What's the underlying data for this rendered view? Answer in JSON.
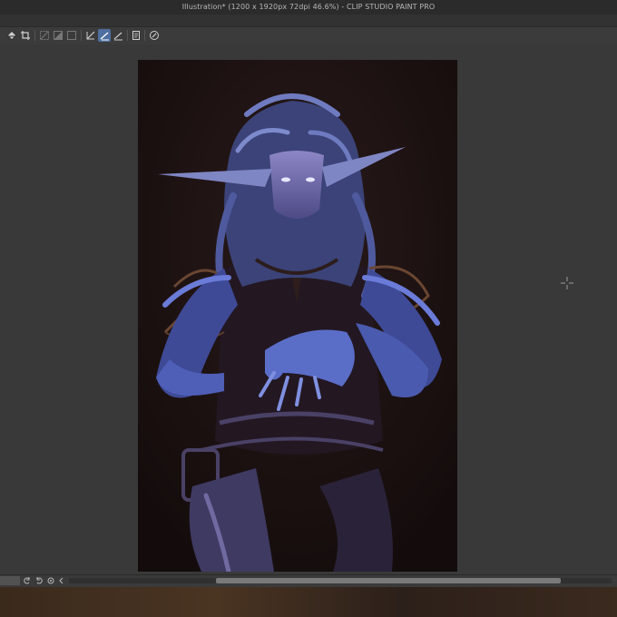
{
  "window": {
    "title": "Illustration* (1200 x 1920px 72dpi 46.6%)  - CLIP STUDIO PAINT PRO"
  },
  "toolbar": {
    "tools": [
      {
        "name": "fill-icon",
        "active": false
      },
      {
        "name": "crop-icon",
        "active": false
      },
      {
        "name": "selection-clear-icon",
        "active": false
      },
      {
        "name": "invert-selection-icon",
        "active": false
      },
      {
        "name": "fill-selection-icon",
        "active": false
      },
      {
        "name": "ruler-icon",
        "active": false
      },
      {
        "name": "snap-ruler-icon",
        "active": true
      },
      {
        "name": "snap-perspective-icon",
        "active": false
      },
      {
        "name": "page-icon",
        "active": false
      },
      {
        "name": "rotate-canvas-icon",
        "active": false
      }
    ]
  },
  "statusbar": {
    "buttons": [
      "rotate-left-icon",
      "rotate-right-icon",
      "reset-rotation-icon",
      "flip-icon"
    ],
    "scroll_position": 0.27,
    "scroll_visible_fraction": 0.64
  },
  "colors": {
    "accent": "#4e6fa0",
    "canvas_bg": "#393939",
    "titlebar_bg": "#2b2b2b",
    "artwork_bg": "#1a1010",
    "figure_blue": "#5a6ec8"
  }
}
